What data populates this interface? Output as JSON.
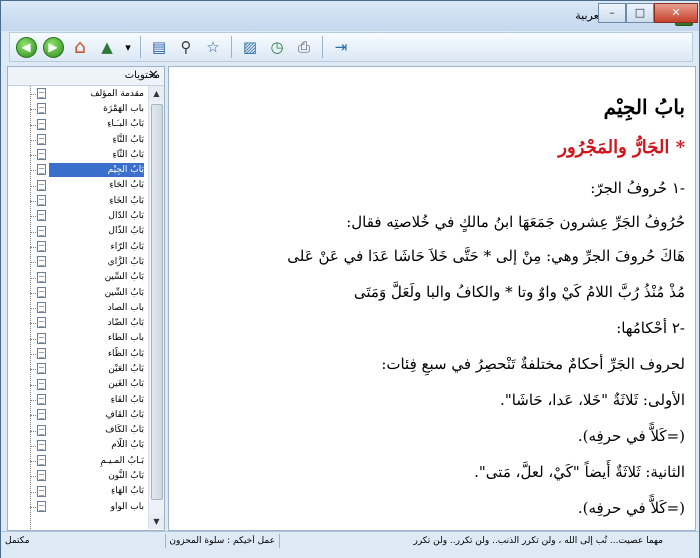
{
  "window": {
    "title": "معجم القواعد العربية",
    "buttons": {
      "minimize": "–",
      "maximize": "□",
      "close": "✕"
    }
  },
  "toolbar": {
    "buttons": [
      {
        "name": "back-button",
        "icon": "back-arrow-icon",
        "glyph": "◀"
      },
      {
        "name": "forward-button",
        "icon": "forward-arrow-icon",
        "glyph": "▶"
      },
      {
        "name": "home-button",
        "icon": "home-icon",
        "glyph": "⌂"
      },
      {
        "name": "tree-button",
        "icon": "tree-icon",
        "glyph": "▲"
      },
      {
        "name": "dropdown-button",
        "icon": "chevron-down-icon",
        "glyph": "▾"
      },
      {
        "name": "contents-pane-button",
        "icon": "pane-icon",
        "glyph": "▤"
      },
      {
        "name": "search-button",
        "icon": "search-icon",
        "glyph": "⚲"
      },
      {
        "name": "favorites-button",
        "icon": "star-icon",
        "glyph": "☆"
      },
      {
        "name": "image-button",
        "icon": "picture-icon",
        "glyph": "▨"
      },
      {
        "name": "history-button",
        "icon": "clock-icon",
        "glyph": "◷"
      },
      {
        "name": "print-button",
        "icon": "printer-icon",
        "glyph": "⎙"
      },
      {
        "name": "exit-button",
        "icon": "exit-icon",
        "glyph": "⇥"
      }
    ]
  },
  "sidebar": {
    "title": "محتويات",
    "close": "✕",
    "items": [
      "مقدمة المؤلف",
      "باب الهَمْزَة",
      "بَابُ البـَـاءِ",
      "بَابُ التَّاءِ",
      "بَابُ الثّاءِ",
      "بَابُ الجِيْم",
      "بَابُ الحَاءِ",
      "بَابُ الخَاءِ",
      "بَابُ الدّال",
      "بَابُ الذّال",
      "بَابُ الرّاء",
      "بَابُ الزَّاي",
      "بَابُ السِّين",
      "بَابُ الشّين",
      "باب الصاد",
      "بَابُ الضّاد",
      "باب الطاء",
      "بَابُ الظّاء",
      "بَابُ العَيْن",
      "بَابُ الغَين",
      "بَابُ الفَاءِ",
      "بَابُ القَافِ",
      "بَابُ الكَاف",
      "بَابُ اللّام",
      "بَـابُ المـيـمِ",
      "بَابُ النُّون",
      "بَابُ الهَاءِ",
      "باب الواو"
    ],
    "selected_index": 5
  },
  "content": {
    "heading": "بابُ الجِيْم",
    "subheading": "* الجَارُّ والمَجْرُور",
    "lines": [
      "-١ حُروفُ الجرّ:",
      "حُرُوفُ الجَرِّ عِشرون جَمَعَهَا ابنُ مالكٍ في خُلاصتِه فقال:",
      "هَاكَ حُروفَ الجرِّ وهي: مِنْ إلى * حَتَّى خَلاَ حَاشَا عَدَا في عَنْ عَلى",
      "مُذْ مُنْذُ رُبَّ اللامُ كَيْ واوٌ وتا * والكافُ والبا ولَعَلَّ وَمَتَى",
      "-٢ أحْكامُها:",
      "لحروف الجَرِّ أحكامٌ مختلفةٌ تَنْحصِرُ في سبعِ فِئات:",
      "الأولى: ثَلاثَةٌ \"خَلا، عَدا، حَاشَا\".",
      "(=كَلاًّ في حرفِه).",
      "الثانية: ثَلاثَةٌ أَيضاً \"كَيْ، لعلَّ، مَتى\".",
      "(=كَلاًّ في حرفِه)."
    ]
  },
  "status": {
    "left": "مكتمل",
    "middle": "عمل أخيكم : سلوة المحزون",
    "right": "مهما عصيت... تُب إلى الله ، ولن تكرر الذنب.. ولن تكرر.. ولن تكرر"
  }
}
